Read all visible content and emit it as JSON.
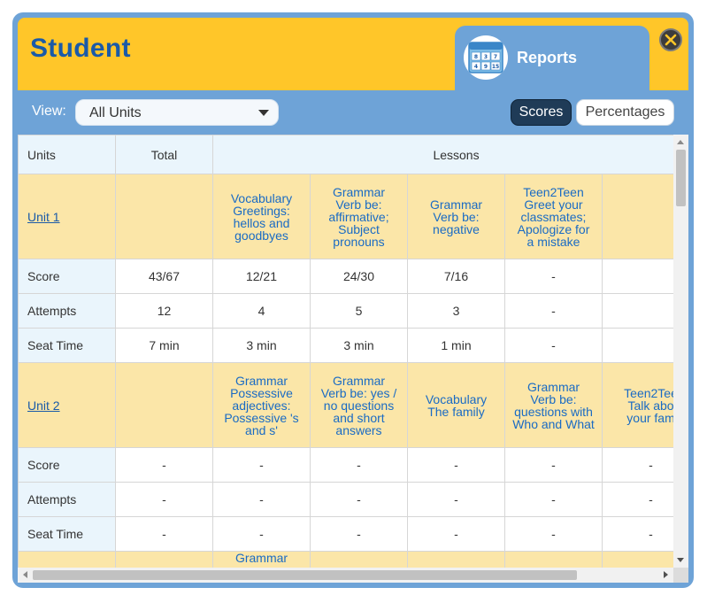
{
  "header": {
    "title": "Student",
    "tab_label": "Reports",
    "tab_icon": "calendar-report-icon",
    "tab_icon_numbers": [
      "8",
      "3",
      "7",
      "4",
      "9",
      "15"
    ]
  },
  "toolbar": {
    "view_label": "View:",
    "view_value": "All Units",
    "scores_label": "Scores",
    "percentages_label": "Percentages",
    "active_toggle": "Scores"
  },
  "table": {
    "columns": {
      "units": "Units",
      "total": "Total",
      "lessons": "Lessons"
    },
    "row_labels": {
      "score": "Score",
      "attempts": "Attempts",
      "seat_time": "Seat Time"
    },
    "units": [
      {
        "name": "Unit 1",
        "lessons": [
          [
            "Vocabulary",
            "Greetings:",
            "hellos and",
            "goodbyes"
          ],
          [
            "Grammar",
            "Verb be:",
            "affirmative;",
            "Subject",
            "pronouns"
          ],
          [
            "Grammar",
            "Verb be:",
            "negative"
          ],
          [
            "Teen2Teen",
            "Greet your",
            "classmates;",
            "Apologize for",
            "a mistake"
          ],
          []
        ],
        "score": [
          "43/67",
          "12/21",
          "24/30",
          "7/16",
          "-",
          ""
        ],
        "attempts": [
          "12",
          "4",
          "5",
          "3",
          "-",
          ""
        ],
        "seat_time": [
          "7 min",
          "3 min",
          "3 min",
          "1 min",
          "-",
          ""
        ]
      },
      {
        "name": "Unit 2",
        "lessons": [
          [
            "Grammar",
            "Possessive",
            "adjectives:",
            "Possessive 's",
            "and s'"
          ],
          [
            "Grammar",
            "Verb be: yes /",
            "no questions",
            "and short",
            "answers"
          ],
          [
            "Vocabulary",
            "The family"
          ],
          [
            "Grammar",
            "Verb be:",
            "questions with",
            "Who and What"
          ],
          [
            "Teen2Tee",
            "Talk abo",
            "your fam"
          ]
        ],
        "score": [
          "-",
          "-",
          "-",
          "-",
          "-",
          "-"
        ],
        "attempts": [
          "-",
          "-",
          "-",
          "-",
          "-",
          "-"
        ],
        "seat_time": [
          "-",
          "-",
          "-",
          "-",
          "-",
          "-"
        ]
      },
      {
        "name": "",
        "lessons": [
          [
            "Grammar"
          ],
          [],
          [],
          [],
          []
        ]
      }
    ]
  },
  "colors": {
    "frame": "#6ea3d7",
    "header": "#ffc629",
    "title": "#1a5aa8",
    "unit_row": "#fbe6a8",
    "label_cell": "#eaf5fc",
    "active_toggle": "#1f3b57"
  }
}
